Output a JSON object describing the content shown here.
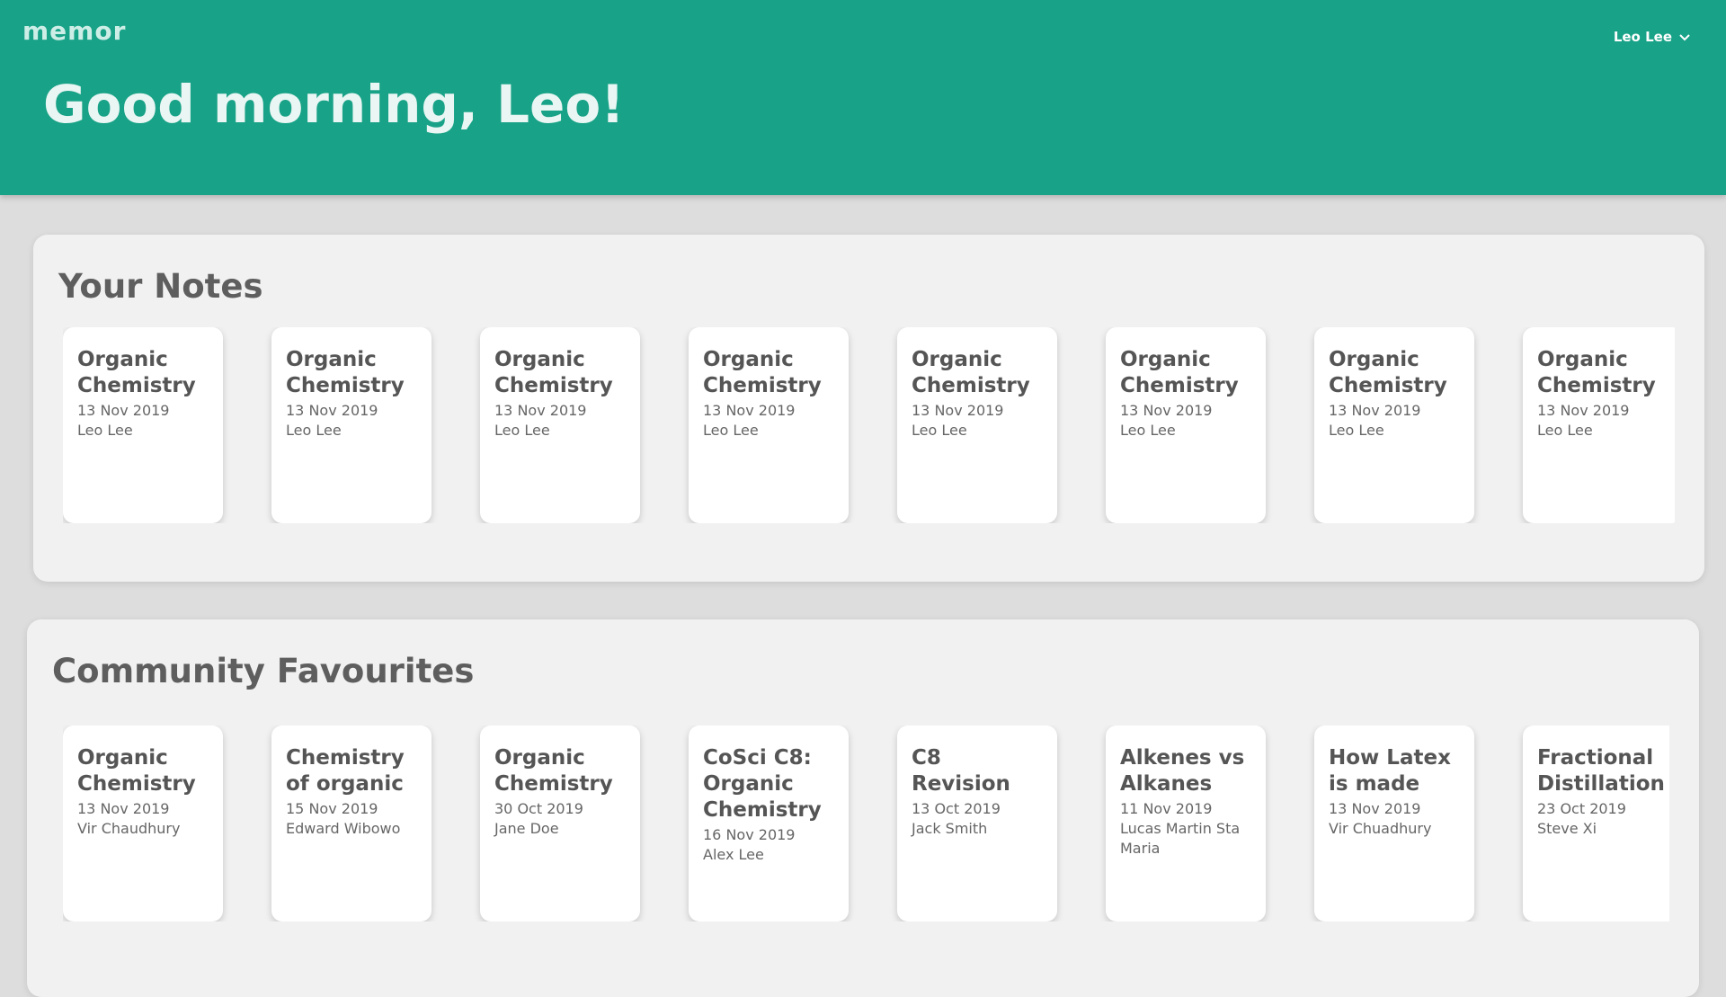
{
  "app": {
    "logo": "memor"
  },
  "user_menu": {
    "name": "Leo Lee",
    "icon": "chevron-down-icon"
  },
  "greeting": "Good morning, Leo!",
  "your_notes": {
    "title": "Your Notes",
    "cards": [
      {
        "title": "Organic Chemistry",
        "date": "13 Nov 2019",
        "author": "Leo Lee"
      },
      {
        "title": "Organic Chemistry",
        "date": "13 Nov 2019",
        "author": "Leo Lee"
      },
      {
        "title": "Organic Chemistry",
        "date": "13 Nov 2019",
        "author": "Leo Lee"
      },
      {
        "title": "Organic Chemistry",
        "date": "13 Nov 2019",
        "author": "Leo Lee"
      },
      {
        "title": "Organic Chemistry",
        "date": "13 Nov 2019",
        "author": "Leo Lee"
      },
      {
        "title": "Organic Chemistry",
        "date": "13 Nov 2019",
        "author": "Leo Lee"
      },
      {
        "title": "Organic Chemistry",
        "date": "13 Nov 2019",
        "author": "Leo Lee"
      },
      {
        "title": "Organic Chemistry",
        "date": "13 Nov 2019",
        "author": "Leo Lee"
      }
    ]
  },
  "community_favourites": {
    "title": "Community Favourites",
    "cards": [
      {
        "title": "Organic Chemistry",
        "date": "13 Nov 2019",
        "author": "Vir Chaudhury"
      },
      {
        "title": "Chemistry of organic",
        "date": "15 Nov 2019",
        "author": "Edward Wibowo"
      },
      {
        "title": "Organic Chemistry",
        "date": "30 Oct 2019",
        "author": "Jane Doe"
      },
      {
        "title": "CoSci C8: Organic Chemistry",
        "date": "16 Nov 2019",
        "author": "Alex Lee"
      },
      {
        "title": "C8 Revision",
        "date": "13 Oct 2019",
        "author": "Jack Smith"
      },
      {
        "title": "Alkenes vs Alkanes",
        "date": "11 Nov 2019",
        "author": "Lucas Martin Sta Maria"
      },
      {
        "title": "How Latex is made",
        "date": "13 Nov 2019",
        "author": "Vir Chuadhury"
      },
      {
        "title": "Fractional Distillation",
        "date": "23 Oct 2019",
        "author": "Steve Xi"
      }
    ]
  },
  "colors": {
    "header": "#18a287",
    "background": "#dddddd",
    "panel": "#f1f1f1",
    "card": "#ffffff"
  }
}
